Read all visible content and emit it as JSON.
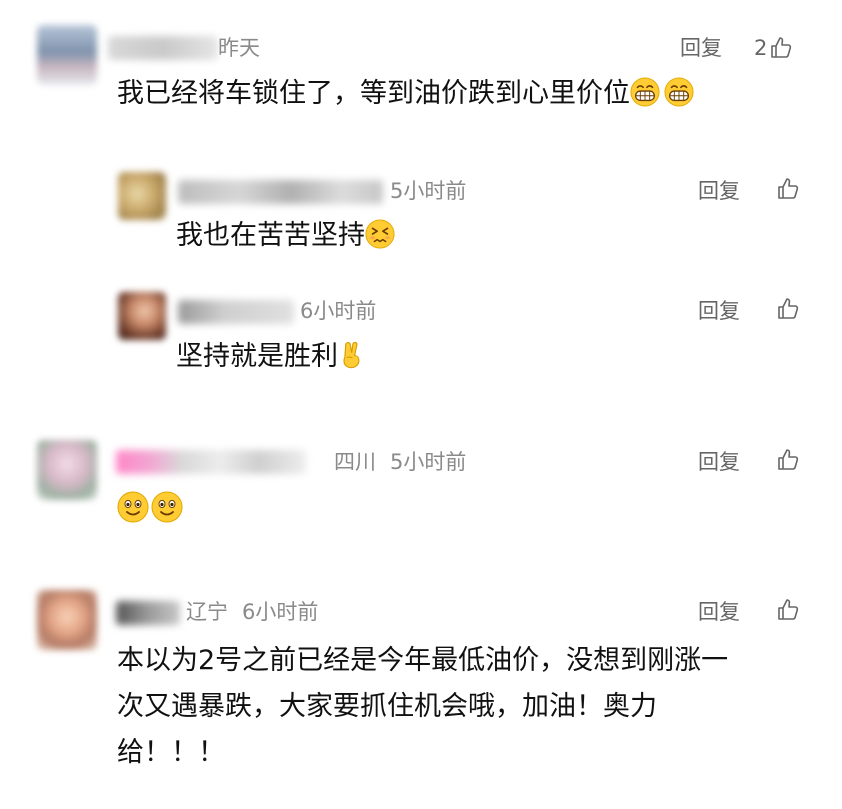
{
  "comments": [
    {
      "time": "昨天",
      "location": "",
      "reply_label": "回复",
      "like_count": "2",
      "text": "我已经将车锁住了，等到油价跌到心里价位",
      "emojis": [
        "grin-emoji",
        "grin-emoji"
      ],
      "replies": [
        {
          "time": "5小时前",
          "reply_label": "回复",
          "text": "我也在苦苦坚持",
          "emojis": [
            "persevere-emoji"
          ]
        },
        {
          "time": "6小时前",
          "reply_label": "回复",
          "text": "坚持就是胜利",
          "emojis": [
            "victory-hand-emoji"
          ]
        }
      ]
    },
    {
      "location": "四川",
      "time": "5小时前",
      "reply_label": "回复",
      "text": "",
      "emojis": [
        "smile-emoji",
        "smile-emoji"
      ]
    },
    {
      "location": "辽宁",
      "time": "6小时前",
      "reply_label": "回复",
      "text_lines": [
        "本以为2号之前已经是今年最低油价，没想到刚涨一",
        "次又遇暴跌，大家要抓住机会哦，加油！奥力",
        "给！！！"
      ]
    }
  ]
}
